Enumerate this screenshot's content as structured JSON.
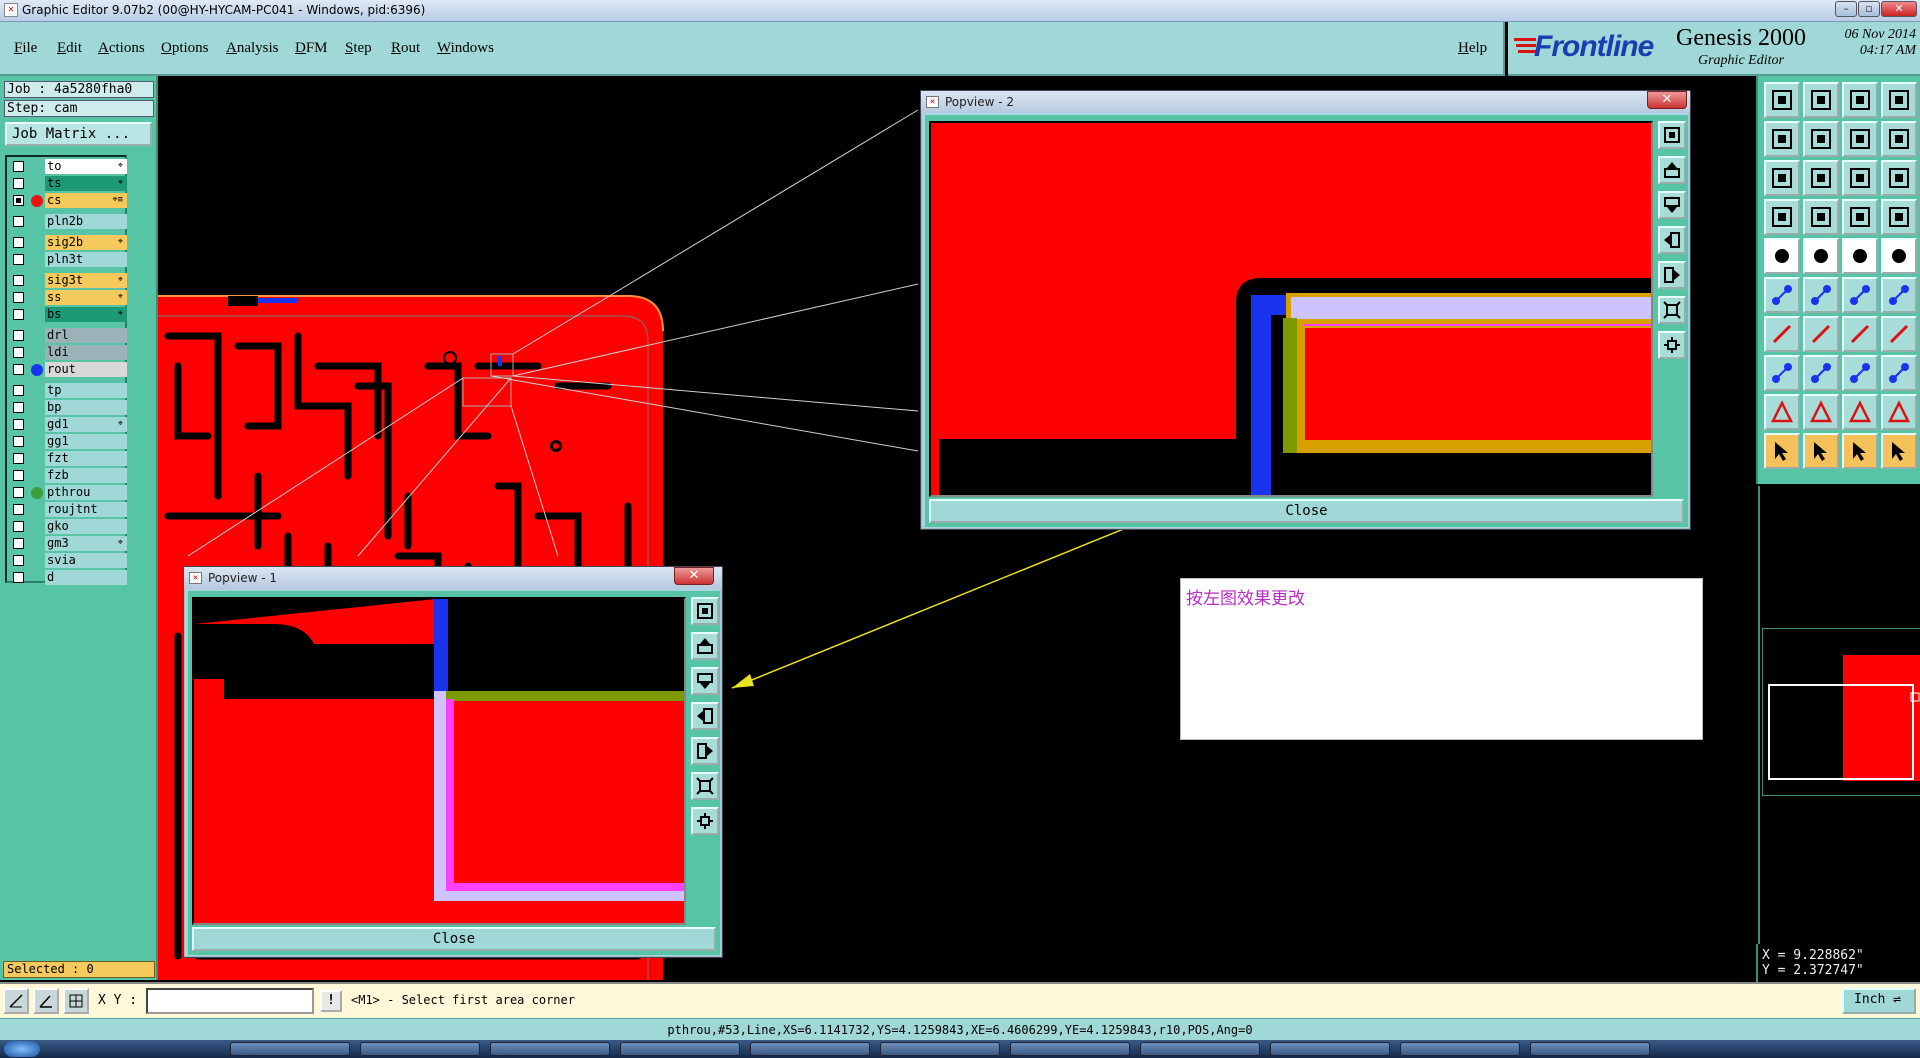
{
  "window": {
    "title": "Graphic Editor 9.07b2 (00@HY-HYCAM-PC041 - Windows, pid:6396)"
  },
  "menu": {
    "items": [
      "File",
      "Edit",
      "Actions",
      "Options",
      "Analysis",
      "DFM",
      "Step",
      "Rout",
      "Windows"
    ],
    "help": "Help"
  },
  "brand": {
    "logo": "Frontline",
    "product": "Genesis 2000",
    "subtitle": "Graphic Editor",
    "date": "06 Nov 2014",
    "time": "04:17 AM"
  },
  "job": {
    "job_label": "Job : 4a5280fha0",
    "step_label": "Step: cam",
    "matrix_button": "Job Matrix ..."
  },
  "layers": [
    {
      "name": "to",
      "color": "#ffffff",
      "checked": false,
      "dot": "",
      "mark": "⌖"
    },
    {
      "name": "ts",
      "color": "#1d9a74",
      "checked": false,
      "dot": "",
      "mark": "⌖"
    },
    {
      "name": "cs",
      "color": "#f6c95d",
      "checked": true,
      "dot": "#ee1111",
      "mark": "⌖≡"
    },
    {
      "name": "pln2b",
      "color": "#9fd8d6",
      "checked": false,
      "dot": "",
      "mark": ""
    },
    {
      "name": "sig2b",
      "color": "#f6c95d",
      "checked": false,
      "dot": "",
      "mark": "⌖"
    },
    {
      "name": "pln3t",
      "color": "#9fd8d6",
      "checked": false,
      "dot": "",
      "mark": ""
    },
    {
      "name": "sig3t",
      "color": "#f6c95d",
      "checked": false,
      "dot": "",
      "mark": "⌖"
    },
    {
      "name": "ss",
      "color": "#f6c95d",
      "checked": false,
      "dot": "",
      "mark": "⌖"
    },
    {
      "name": "bs",
      "color": "#1d9a74",
      "checked": false,
      "dot": "",
      "mark": "⌖"
    },
    {
      "name": "drl",
      "color": "#9bb2b8",
      "checked": false,
      "dot": "",
      "mark": ""
    },
    {
      "name": "ldi",
      "color": "#9bb2b8",
      "checked": false,
      "dot": "",
      "mark": ""
    },
    {
      "name": "rout",
      "color": "#d8d8d8",
      "checked": false,
      "dot": "#1a33ee",
      "mark": ""
    },
    {
      "name": "tp",
      "color": "#9fd8d6",
      "checked": false,
      "dot": "",
      "mark": ""
    },
    {
      "name": "bp",
      "color": "#9fd8d6",
      "checked": false,
      "dot": "",
      "mark": ""
    },
    {
      "name": "gd1",
      "color": "#9fd8d6",
      "checked": false,
      "dot": "",
      "mark": "⌖"
    },
    {
      "name": "gg1",
      "color": "#9fd8d6",
      "checked": false,
      "dot": "",
      "mark": ""
    },
    {
      "name": "fzt",
      "color": "#9fd8d6",
      "checked": false,
      "dot": "",
      "mark": ""
    },
    {
      "name": "fzb",
      "color": "#9fd8d6",
      "checked": false,
      "dot": "",
      "mark": ""
    },
    {
      "name": "pthrou",
      "color": "#9fd8d6",
      "checked": false,
      "dot": "#3aa03a",
      "mark": ""
    },
    {
      "name": "roujtnt",
      "color": "#9fd8d6",
      "checked": false,
      "dot": "",
      "mark": ""
    },
    {
      "name": "gko",
      "color": "#9fd8d6",
      "checked": false,
      "dot": "",
      "mark": ""
    },
    {
      "name": "gm3",
      "color": "#9fd8d6",
      "checked": false,
      "dot": "",
      "mark": "⌖"
    },
    {
      "name": "svia",
      "color": "#9fd8d6",
      "checked": false,
      "dot": "",
      "mark": ""
    },
    {
      "name": "d",
      "color": "#9fd8d6",
      "checked": false,
      "dot": "",
      "mark": ""
    }
  ],
  "selected": "Selected : 0",
  "popview2": {
    "title": "Popview - 2",
    "close": "Close",
    "close_x": "✕"
  },
  "popview1": {
    "title": "Popview - 1",
    "close": "Close",
    "close_x": "✕"
  },
  "note": {
    "text": "按左图效果更改"
  },
  "coords": {
    "x": "X = 9.228862\"",
    "y": "Y = 2.372747\""
  },
  "command": {
    "xy_label": "X Y :",
    "xy_value": "",
    "bang": "!",
    "prompt": "<M1> - Select first area corner",
    "unit": "Inch"
  },
  "status": "pthrou,#53,Line,XS=6.1141732,YS=4.1259843,XE=6.4606299,YE=4.1259843,r10,POS,Ang=0",
  "colors": {
    "board": "#ff0000",
    "copper_blue": "#1a33ee",
    "highlight_yellow": "#f5c15a",
    "panel_teal": "#57c4a6",
    "menu_teal": "#9fd8d6",
    "note_magenta": "#b82cc4"
  },
  "tools": [
    "open-job-icon",
    "save-icon",
    "home-icon",
    "zoom-window-icon",
    "previous-icon",
    "next-icon",
    "pan-icon",
    "undo-zoom-icon",
    "fit-icon",
    "zoom-all-icon",
    "scale-icon",
    "help-icon",
    "measure-icon",
    "grid-icon",
    "snap-icon",
    "layer-snap-icon",
    "add-pad-icon",
    "add-line-icon",
    "ruler-icon",
    "circle-icon",
    "node-icon",
    "move-icon",
    "connect-icon",
    "edit-icon",
    "draw-line-icon",
    "slope-icon",
    "arc-icon",
    "pattern-icon",
    "pad-edit-icon",
    "trace-icon",
    "split-icon",
    "copy-icon",
    "triangle-icon",
    "triangle-a-icon",
    "triangle-b-icon",
    "triangle-c-icon",
    "select-icon",
    "select-highlight-icon",
    "select-pointer-icon",
    "select-area-icon"
  ]
}
